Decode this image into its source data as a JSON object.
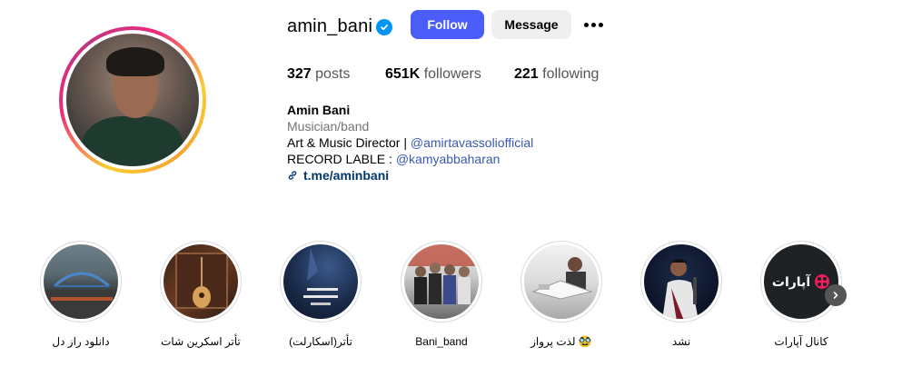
{
  "profile": {
    "username": "amin_bani",
    "follow_label": "Follow",
    "message_label": "Message",
    "posts_count": "327",
    "posts_label": "posts",
    "followers_count": "651K",
    "followers_label": "followers",
    "following_count": "221",
    "following_label": "following",
    "full_name": "Amin Bani",
    "category": "Musician/band",
    "bio_line1_prefix": "Art & Music Director | ",
    "bio_line1_mention": "@amirtavassoliofficial",
    "bio_line2_prefix": "RECORD LABLE : ",
    "bio_line2_mention": "@kamyabbaharan",
    "link_text": "t.me/aminbani"
  },
  "highlights": [
    {
      "label": "دانلود راز دل"
    },
    {
      "label": "تأتر اسکرین شات"
    },
    {
      "label": "تأتر(اسکارلت)"
    },
    {
      "label": "Bani_band"
    },
    {
      "label": "لذت پرواز 🥸"
    },
    {
      "label": "نشد"
    },
    {
      "label": "کانال آپارات",
      "image_text": "آپارات"
    }
  ],
  "icons": {
    "verified": "verified-badge-icon",
    "more": "more-options-icon",
    "link": "link-icon",
    "next": "chevron-right-icon"
  },
  "colors": {
    "follow_button": "#4a5df9",
    "verified": "#0095f6",
    "link": "#00376b",
    "mention": "#3a5ab0"
  }
}
